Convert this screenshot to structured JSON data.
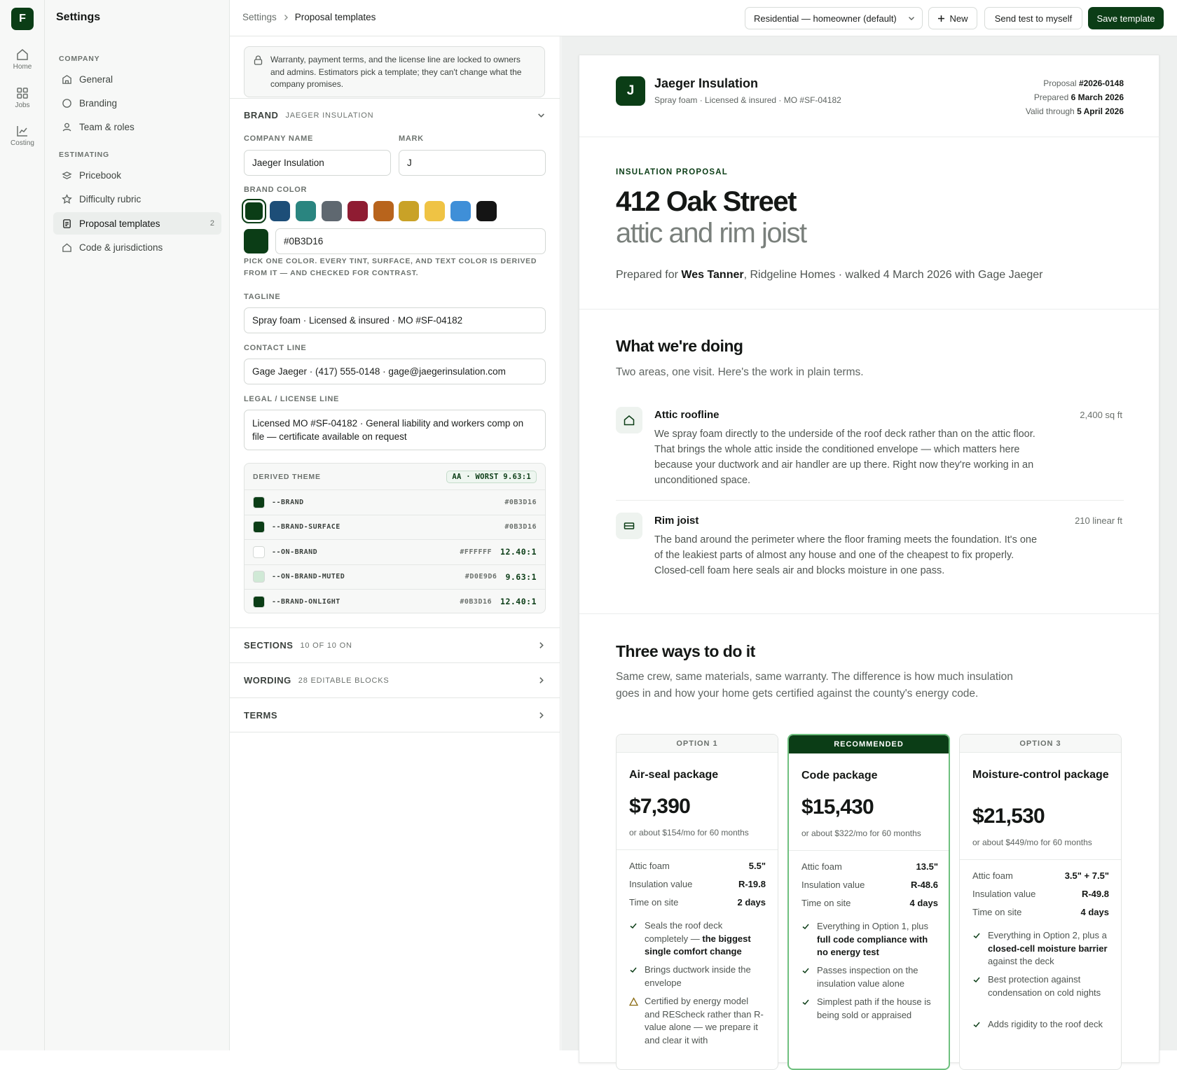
{
  "rail": {
    "logo": "F",
    "items": [
      {
        "label": "Home",
        "icon": "home-icon"
      },
      {
        "label": "Jobs",
        "icon": "grid-icon"
      },
      {
        "label": "Costing",
        "icon": "chart-icon"
      }
    ]
  },
  "sidebar": {
    "title": "Settings",
    "company_heading": "COMPANY",
    "estimating_heading": "ESTIMATING",
    "items": [
      {
        "label": "General",
        "icon": "building-icon"
      },
      {
        "label": "Branding",
        "icon": "palette-icon"
      },
      {
        "label": "Team & roles",
        "icon": "user-icon"
      },
      {
        "label": "Pricebook",
        "icon": "layers-icon"
      },
      {
        "label": "Difficulty rubric",
        "icon": "star-icon"
      },
      {
        "label": "Proposal templates",
        "icon": "document-icon",
        "count": "2",
        "active": true
      },
      {
        "label": "Code & jurisdictions",
        "icon": "house-icon"
      }
    ]
  },
  "topbar": {
    "breadcrumb_root": "Settings",
    "breadcrumb_current": "Proposal templates",
    "template_select": "Residential — homeowner (default)",
    "new_label": "New",
    "send_test_label": "Send test to myself",
    "save_label": "Save template"
  },
  "editor": {
    "lock_note": "Warranty, payment terms, and the license line are locked to owners and admins. Estimators pick a template; they can't change what the company promises.",
    "brand": {
      "heading": "BRAND",
      "subheading": "JAEGER INSULATION",
      "company_name_label": "COMPANY NAME",
      "company_name_value": "Jaeger Insulation",
      "mark_label": "MARK",
      "mark_value": "J",
      "brand_color_label": "BRAND COLOR",
      "swatches": [
        "#0b3d16",
        "#1d4e78",
        "#2a8580",
        "#5f6870",
        "#8f1c32",
        "#b8641c",
        "#c9a227",
        "#efc344",
        "#3f8fd8",
        "#141414"
      ],
      "selected_color": "#0B3D16",
      "color_hint": "PICK ONE COLOR. EVERY TINT, SURFACE, AND TEXT COLOR IS DERIVED FROM IT — AND CHECKED FOR CONTRAST.",
      "tagline_label": "TAGLINE",
      "tagline_value": "Spray foam · Licensed & insured · MO #SF-04182",
      "contact_label": "CONTACT LINE",
      "contact_value": "Gage Jaeger · (417) 555-0148 · gage@jaegerinsulation.com",
      "legal_label": "LEGAL / LICENSE LINE",
      "legal_value": "Licensed MO #SF-04182 · General liability and workers comp on file — certificate available on request"
    },
    "theme": {
      "heading": "DERIVED THEME",
      "badge": "AA · WORST 9.63:1",
      "rows": [
        {
          "name": "--BRAND",
          "hex": "#0B3D16",
          "swatch": "#0b3d16",
          "contrast": ""
        },
        {
          "name": "--BRAND-SURFACE",
          "hex": "#0B3D16",
          "swatch": "#0b3d16",
          "contrast": ""
        },
        {
          "name": "--ON-BRAND",
          "hex": "#FFFFFF",
          "swatch": "#ffffff",
          "contrast": "12.40:1"
        },
        {
          "name": "--ON-BRAND-MUTED",
          "hex": "#D0E9D6",
          "swatch": "#d0e9d6",
          "contrast": "9.63:1"
        },
        {
          "name": "--BRAND-ONLIGHT",
          "hex": "#0B3D16",
          "swatch": "#0b3d16",
          "contrast": "12.40:1"
        }
      ]
    },
    "sections": {
      "heading": "SECTIONS",
      "sub": "10 OF 10 ON"
    },
    "wording": {
      "heading": "WORDING",
      "sub": "28 EDITABLE BLOCKS"
    },
    "terms": {
      "heading": "TERMS"
    }
  },
  "proposal": {
    "mark": "J",
    "company": "Jaeger Insulation",
    "tagline": "Spray foam · Licensed & insured · MO #SF-04182",
    "meta": {
      "proposal_label": "Proposal",
      "proposal_no": "#2026-0148",
      "prepared_label": "Prepared",
      "prepared": "6 March 2026",
      "valid_label": "Valid through",
      "valid": "5 April 2026"
    },
    "eyebrow": "INSULATION PROPOSAL",
    "title": "412 Oak Street",
    "subtitle": "attic and rim joist",
    "prepared_for_prefix": "Prepared for",
    "client": "Wes Tanner",
    "prepared_for_rest": ", Ridgeline Homes · walked 4 March 2026 with Gage Jaeger",
    "work": {
      "heading": "What we're doing",
      "lead": "Two areas, one visit. Here's the work in plain terms.",
      "areas": [
        {
          "title": "Attic roofline",
          "qty": "2,400 sq ft",
          "desc": "We spray foam directly to the underside of the roof deck rather than on the attic floor. That brings the whole attic inside the conditioned envelope — which matters here because your ductwork and air handler are up there. Right now they're working in an unconditioned space."
        },
        {
          "title": "Rim joist",
          "qty": "210 linear ft",
          "desc": "The band around the perimeter where the floor framing meets the foundation. It's one of the leakiest parts of almost any house and one of the cheapest to fix properly. Closed-cell foam here seals air and blocks moisture in one pass."
        }
      ]
    },
    "options_section": {
      "heading": "Three ways to do it",
      "lead": "Same crew, same materials, same warranty. The difference is how much insulation goes in and how your home gets certified against the county's energy code."
    },
    "options": [
      {
        "header": "OPTION 1",
        "name": "Air-seal package",
        "price": "$7,390",
        "monthly": "or about $154/mo for 60 months",
        "specs": [
          {
            "label": "Attic foam",
            "value": "5.5\""
          },
          {
            "label": "Insulation value",
            "value": "R-19.8"
          },
          {
            "label": "Time on site",
            "value": "2 days"
          }
        ],
        "features": [
          {
            "icon": "check-icon",
            "text": "Seals the roof deck completely — ",
            "bold": "the biggest single comfort change",
            "after": ""
          },
          {
            "icon": "check-icon",
            "text": "Brings ductwork inside the envelope",
            "bold": "",
            "after": ""
          },
          {
            "icon": "warning-icon",
            "text": "Certified by energy model and REScheck rather than R-value alone — we prepare it and clear it with",
            "bold": "",
            "after": ""
          }
        ]
      },
      {
        "header": "RECOMMENDED",
        "name": "Code package",
        "price": "$15,430",
        "monthly": "or about $322/mo for 60 months",
        "specs": [
          {
            "label": "Attic foam",
            "value": "13.5\""
          },
          {
            "label": "Insulation value",
            "value": "R-48.6"
          },
          {
            "label": "Time on site",
            "value": "4 days"
          }
        ],
        "features": [
          {
            "icon": "check-icon",
            "text": "Everything in Option 1, plus ",
            "bold": "full code compliance with no energy test",
            "after": ""
          },
          {
            "icon": "check-icon",
            "text": "Passes inspection on the insulation value alone",
            "bold": "",
            "after": ""
          },
          {
            "icon": "check-icon",
            "text": "Simplest path if the house is being sold or appraised",
            "bold": "",
            "after": ""
          }
        ]
      },
      {
        "header": "OPTION 3",
        "name": "Moisture-control package",
        "price": "$21,530",
        "monthly": "or about $449/mo for 60 months",
        "specs": [
          {
            "label": "Attic foam",
            "value": "3.5\" + 7.5\""
          },
          {
            "label": "Insulation value",
            "value": "R-49.8"
          },
          {
            "label": "Time on site",
            "value": "4 days"
          }
        ],
        "features": [
          {
            "icon": "check-icon",
            "text": "Everything in Option 2, plus a ",
            "bold": "closed-cell moisture barrier",
            "after": " against the deck"
          },
          {
            "icon": "check-icon",
            "text": "Best protection against condensation on cold nights",
            "bold": "",
            "after": ""
          },
          {
            "icon": "check-icon",
            "text": "Adds rigidity to the roof deck",
            "bold": "",
            "after": ""
          }
        ]
      }
    ]
  }
}
